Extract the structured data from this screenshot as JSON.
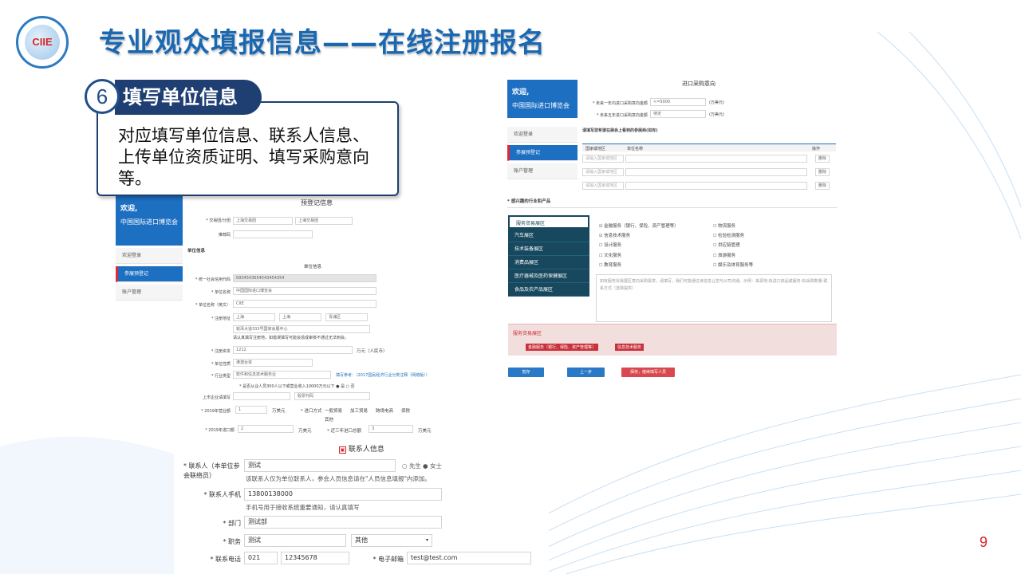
{
  "header": {
    "logo_text": "CIIE",
    "title": "专业观众填报信息——在线注册报名"
  },
  "step": {
    "number": "6",
    "heading": "填写单位信息",
    "description": "对应填写单位信息、联系人信息、上传单位资质证明、填写采购意向等。"
  },
  "left_form": {
    "banner_title": "欢迎,",
    "banner_sub": "中国国际进口博览会",
    "menu": [
      "欢迎登录",
      "参展预登记",
      "账户管理"
    ],
    "prereg_title": "预登记信息",
    "trade_group_label": "* 交易团/分团",
    "trade_group_value": "上海交易团",
    "trade_subgroup_value": "上海交易团",
    "recommend_label": "推荐码",
    "unit_section": "单位信息",
    "unit_info_title": "单位信息",
    "credit_code_label": "* 统一社会信用代码",
    "credit_code_value": "0934543654543454354",
    "unit_name_label": "* 单位名称",
    "unit_name_value": "中国国际进口博览会",
    "unit_name_en_label": "* 单位名称（英文）",
    "unit_name_en_value": "CIIE",
    "reg_address_label": "* 注册地址",
    "addr_province": "上海",
    "addr_city": "上海",
    "addr_district": "青浦区",
    "addr_detail": "崧泽大道333号国家会展中心",
    "addr_hint": "请认真填写注册地，如错误填写可能会造成审核不通过无法到会。",
    "reg_capital_label": "* 注册资本",
    "reg_capital_value": "1212",
    "reg_capital_unit": "万元（人民币）",
    "unit_nature_label": "* 单位性质",
    "unit_nature_value": "港澳台资",
    "industry_label": "* 行业类型",
    "industry_value": "软件和信息技术服务业",
    "industry_ref": "填写参考：（2017国民经济行业分类注释（网络版））",
    "sme_question": "* 是否从业人员300人以下或营业收入10000万元以下 ● 是 ○ 否",
    "listed_label": "上市企业请填写",
    "stock_code_placeholder": "股票代码",
    "revenue_label": "* 2019年营业额",
    "revenue_value": "1",
    "revenue_unit": "万美元",
    "import_method_label": "* 进口方式",
    "import_methods": [
      "一般贸易",
      "加工贸易",
      "跨境电商",
      "保税",
      "其他"
    ],
    "import_amount_label": "* 2019年进口额",
    "import_amount_value": "2",
    "import_amount_unit": "万美元",
    "import_3yr_label": "* 近三年进口总额",
    "import_3yr_value": "3",
    "import_3yr_unit": "万美元"
  },
  "contact_form": {
    "section_title": "联系人信息",
    "contact_label": "* 联系人（本单位参会联络员）",
    "contact_value": "测试",
    "gender_male": "先生",
    "gender_female": "女士",
    "contact_hint": "该联系人仅为单位联系人，参会人员信息请在\"人员信息填报\"内添加。",
    "mobile_label": "* 联系人手机",
    "mobile_value": "13800138000",
    "mobile_hint": "手机号用于接收系统重要通知，请认真填写",
    "dept_label": "* 部门",
    "dept_value": "测试部",
    "position_label": "* 职务",
    "position_value": "测试",
    "position_select": "其他",
    "phone_label": "* 联系电话",
    "phone_area": "021",
    "phone_number": "12345678",
    "email_label": "* 电子邮箱",
    "email_value": "test@test.com"
  },
  "right_form": {
    "banner_title": "欢迎,",
    "banner_sub": "中国国际进口博览会",
    "menu": [
      "欢迎登录",
      "参展预登记",
      "账户管理"
    ],
    "purchase_title": "进口采购意向",
    "next_year_label": "* 未来一年内进口采购意向金额",
    "next_year_value": "<=5000",
    "next_year_unit": "(万美元)",
    "five_year_label": "* 未来五年进口采购意向金额",
    "five_year_value": "待定",
    "five_year_unit": "(万美元)",
    "exhibitor_hint": "请填写您希望在展会上看到的参展商(如有)",
    "table_headers": [
      "国家或地区",
      "单位名称",
      "操作"
    ],
    "table_rows": [
      {
        "country": "请输入国家或地区",
        "action": "删除"
      },
      {
        "country": "请输入国家或地区",
        "action": "删除"
      },
      {
        "country": "请输入国家或地区",
        "action": "删除"
      }
    ],
    "industry_title": "* 感兴趣的行业和产品",
    "industries": [
      "服务贸易展区",
      "汽车展区",
      "技术装备展区",
      "消费品展区",
      "医疗器械及医药保健展区",
      "食品及农产品展区"
    ],
    "services_left": [
      "金融服务（银行、保险、资产管理等）",
      "信息技术服务",
      "设计服务",
      "文化服务",
      "教育服务"
    ],
    "services_left_checked": [
      true,
      true,
      false,
      false,
      false
    ],
    "services_right": [
      "物流服务",
      "检验检测服务",
      "供应链管理",
      "旅游服务",
      "娱乐及体育服务等"
    ],
    "textarea_placeholder": "如有服务贸易展区意向采购需求，请填写，我们可能通过该信息让您与公司沟通。示例：来源地-拟进口商品或服务-拟采购数量-联系方式（选择提供）",
    "selected_section": "服务贸易展区",
    "selected_tags": [
      "金融服务（银行、保险、资产管理等）",
      "信息技术服务"
    ],
    "buttons": {
      "save": "暂存",
      "prev": "上一步",
      "next": "保存，继续填写人员"
    }
  },
  "page_number": "9",
  "colors": {
    "title_blue": "#1a68b2",
    "callout_navy": "#1f3f73",
    "page_num_red": "#d5262c",
    "menu_blue": "#1d6fc2",
    "industry_teal": "#17485e"
  }
}
